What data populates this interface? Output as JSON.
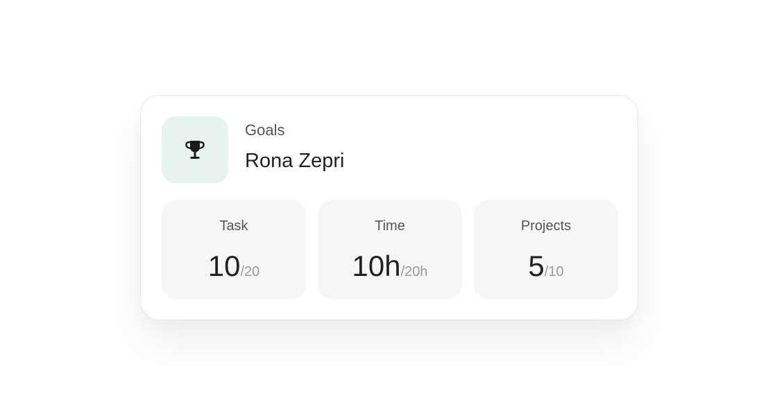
{
  "card": {
    "kicker": "Goals",
    "name": "Rona Zepri",
    "icon": "trophy-icon",
    "icon_bg_color": "#e6f3ef"
  },
  "stats": [
    {
      "label": "Task",
      "value": "10",
      "total": "/20"
    },
    {
      "label": "Time",
      "value": "10h",
      "total": "/20h"
    },
    {
      "label": "Projects",
      "value": "5",
      "total": "/10"
    }
  ]
}
